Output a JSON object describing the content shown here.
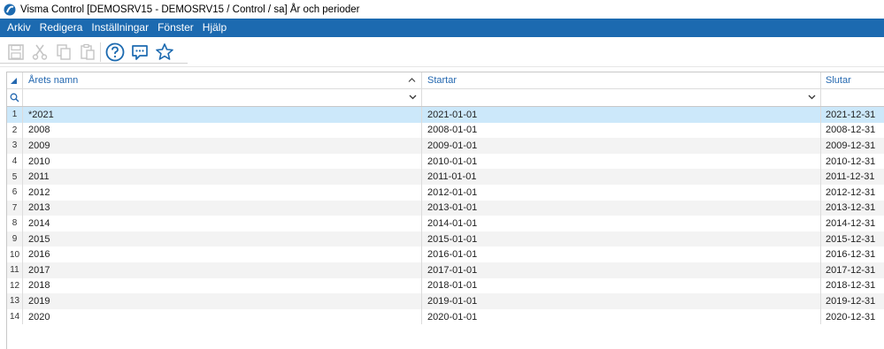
{
  "window": {
    "title": "Visma Control [DEMOSRV15 - DEMOSRV15 / Control / sa] År och perioder"
  },
  "menu": {
    "items": [
      "Arkiv",
      "Redigera",
      "Inställningar",
      "Fönster",
      "Hjälp"
    ]
  },
  "toolbar": {
    "icons": [
      "save-icon",
      "cut-icon",
      "copy-icon",
      "paste-icon",
      "help-icon",
      "chat-icon",
      "star-icon"
    ],
    "accent": "#1c6ab0"
  },
  "grid": {
    "columns": [
      "Årets namn",
      "Startar",
      "Slutar"
    ],
    "rows": [
      {
        "num": "1",
        "name": "*2021",
        "start": "2021-01-01",
        "end": "2021-12-31"
      },
      {
        "num": "2",
        "name": "2008",
        "start": "2008-01-01",
        "end": "2008-12-31"
      },
      {
        "num": "3",
        "name": "2009",
        "start": "2009-01-01",
        "end": "2009-12-31"
      },
      {
        "num": "4",
        "name": "2010",
        "start": "2010-01-01",
        "end": "2010-12-31"
      },
      {
        "num": "5",
        "name": "2011",
        "start": "2011-01-01",
        "end": "2011-12-31"
      },
      {
        "num": "6",
        "name": "2012",
        "start": "2012-01-01",
        "end": "2012-12-31"
      },
      {
        "num": "7",
        "name": "2013",
        "start": "2013-01-01",
        "end": "2013-12-31"
      },
      {
        "num": "8",
        "name": "2014",
        "start": "2014-01-01",
        "end": "2014-12-31"
      },
      {
        "num": "9",
        "name": "2015",
        "start": "2015-01-01",
        "end": "2015-12-31"
      },
      {
        "num": "10",
        "name": "2016",
        "start": "2016-01-01",
        "end": "2016-12-31"
      },
      {
        "num": "11",
        "name": "2017",
        "start": "2017-01-01",
        "end": "2017-12-31"
      },
      {
        "num": "12",
        "name": "2018",
        "start": "2018-01-01",
        "end": "2018-12-31"
      },
      {
        "num": "13",
        "name": "2019",
        "start": "2019-01-01",
        "end": "2019-12-31"
      },
      {
        "num": "14",
        "name": "2020",
        "start": "2020-01-01",
        "end": "2020-12-31"
      }
    ]
  }
}
